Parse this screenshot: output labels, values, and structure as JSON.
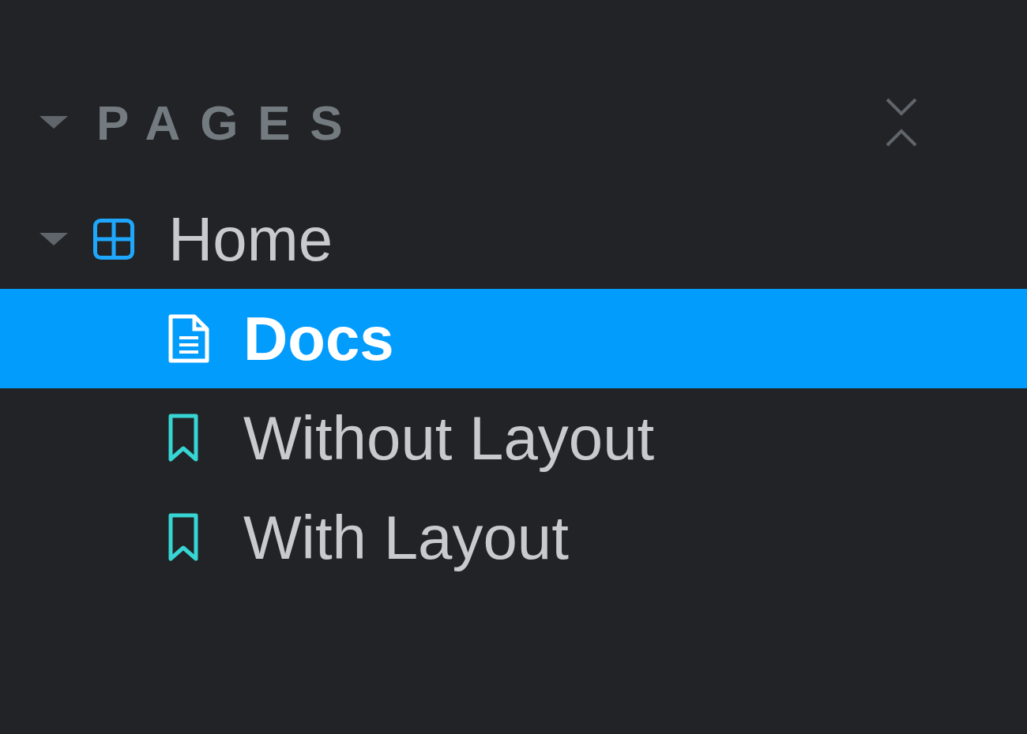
{
  "section": {
    "title": "PAGES",
    "expanded": true
  },
  "tree": [
    {
      "label": "Home",
      "kind": "component",
      "expanded": true,
      "selected": false,
      "children": [
        {
          "label": "Docs",
          "kind": "docs",
          "selected": true
        },
        {
          "label": "Without Layout",
          "kind": "story",
          "selected": false
        },
        {
          "label": "With Layout",
          "kind": "story",
          "selected": false
        }
      ]
    }
  ]
}
